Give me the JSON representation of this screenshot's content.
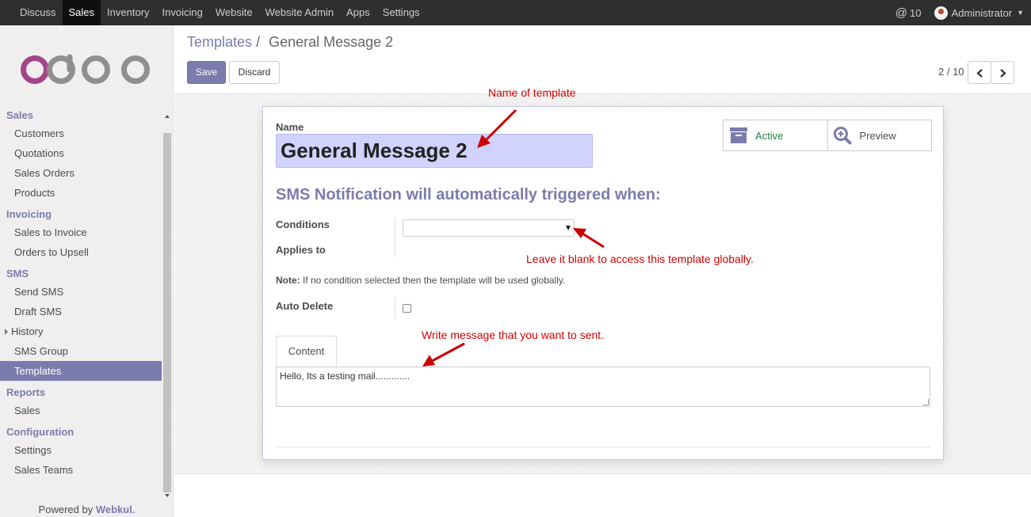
{
  "topbar": {
    "menu": [
      "Discuss",
      "Sales",
      "Inventory",
      "Invoicing",
      "Website",
      "Website Admin",
      "Apps",
      "Settings"
    ],
    "active_menu": "Sales",
    "messages_count": "10",
    "user": "Administrator"
  },
  "sidebar": {
    "sections": [
      {
        "title": "Sales",
        "items": [
          "Customers",
          "Quotations",
          "Sales Orders",
          "Products"
        ]
      },
      {
        "title": "Invoicing",
        "items": [
          "Sales to Invoice",
          "Orders to Upsell"
        ]
      },
      {
        "title": "SMS",
        "items": [
          "Send SMS",
          "Draft SMS",
          "History",
          "SMS Group",
          "Templates"
        ]
      },
      {
        "title": "Reports",
        "items": [
          "Sales"
        ]
      },
      {
        "title": "Configuration",
        "items": [
          "Settings",
          "Sales Teams"
        ]
      }
    ],
    "active_item": "Templates",
    "powered_prefix": "Powered by",
    "powered_brand": "Webkul."
  },
  "control_panel": {
    "breadcrumb_link": "Templates",
    "breadcrumb_sep": "/",
    "breadcrumb_current": "General Message 2",
    "save_label": "Save",
    "discard_label": "Discard",
    "pager": "2 / 10"
  },
  "form": {
    "name_label": "Name",
    "name_value": "General Message 2",
    "active_label": "Active",
    "preview_label": "Preview",
    "section_title": "SMS Notification will automatically triggered when:",
    "conditions_label": "Conditions",
    "applies_to_label": "Applies to",
    "note_bold": "Note:",
    "note_text": " If no condition selected then the template will be used globally.",
    "auto_delete_label": "Auto Delete",
    "auto_delete_checked": false,
    "tab_content": "Content",
    "content_value": "Hello, Its a testing mail............."
  },
  "annotations": {
    "name": "Name of template",
    "blank": "Leave it blank to access this template globally.",
    "message": "Write message that you want to sent."
  },
  "colors": {
    "brand": "#7c7bad",
    "annotation": "#d40000",
    "active_green": "#218542"
  }
}
